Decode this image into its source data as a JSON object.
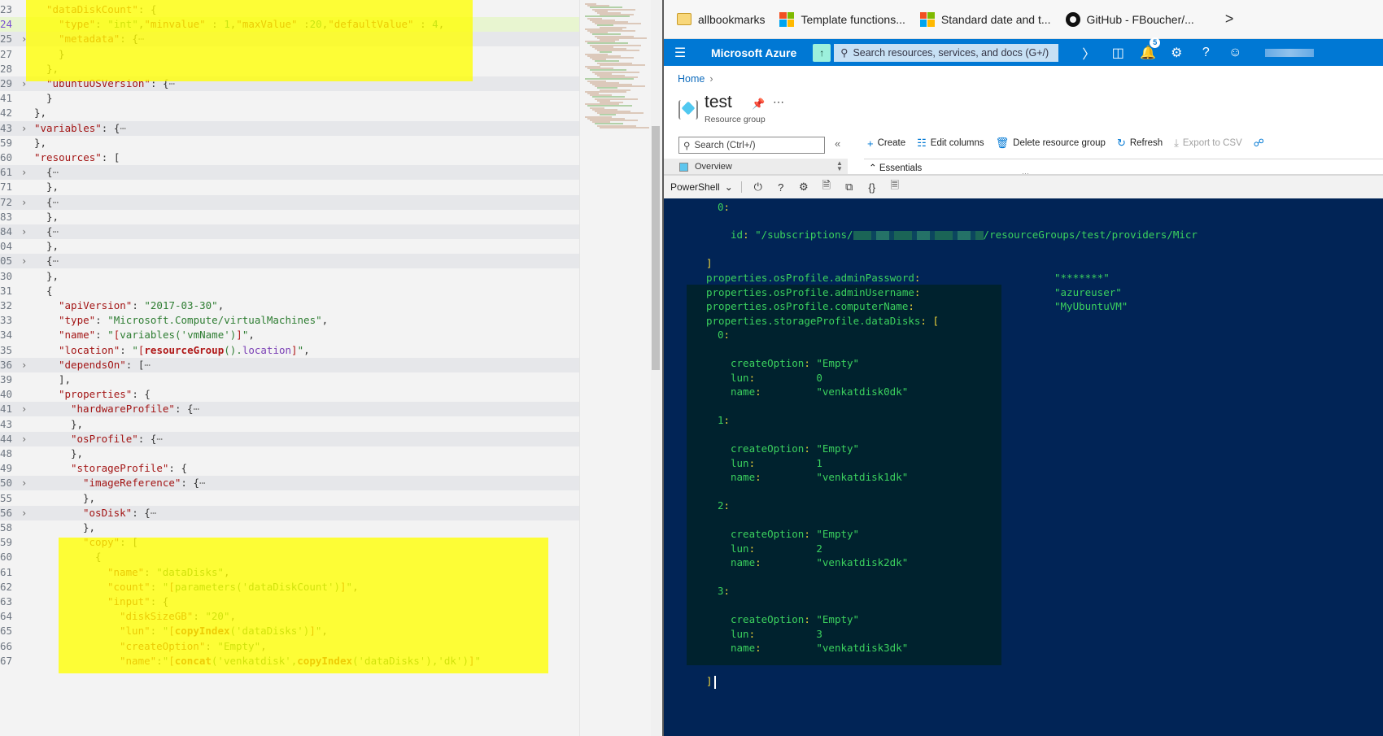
{
  "editor": {
    "lines": [
      {
        "ln": "23",
        "fold": false,
        "html_key": "dataDiskCount_open",
        "indent": 2
      },
      {
        "ln": "24",
        "fold": false,
        "html_key": "type_line",
        "indent": 3,
        "active": true
      },
      {
        "ln": "25",
        "fold": true,
        "html_key": "metadata",
        "indent": 3
      },
      {
        "ln": "27",
        "fold": false,
        "html_key": "close_brace",
        "indent": 3
      },
      {
        "ln": "28",
        "fold": false,
        "html_key": "close_brace_comma",
        "indent": 2
      },
      {
        "ln": "29",
        "fold": true,
        "html_key": "ubuntuOSVersion",
        "indent": 2
      },
      {
        "ln": "41",
        "fold": false,
        "html_key": "close_brace",
        "indent": 2
      },
      {
        "ln": "42",
        "fold": false,
        "html_key": "close_brace_comma",
        "indent": 1
      },
      {
        "ln": "43",
        "fold": true,
        "html_key": "variables",
        "indent": 1
      },
      {
        "ln": "59",
        "fold": false,
        "html_key": "close_brace_comma",
        "indent": 1
      },
      {
        "ln": "60",
        "fold": false,
        "html_key": "resources",
        "indent": 1
      },
      {
        "ln": "61",
        "fold": true,
        "html_key": "obj_folded",
        "indent": 2
      },
      {
        "ln": "71",
        "fold": false,
        "html_key": "close_brace_comma",
        "indent": 2
      },
      {
        "ln": "72",
        "fold": true,
        "html_key": "obj_folded",
        "indent": 2
      },
      {
        "ln": "83",
        "fold": false,
        "html_key": "close_brace_comma",
        "indent": 2
      },
      {
        "ln": "84",
        "fold": true,
        "html_key": "obj_folded",
        "indent": 2
      },
      {
        "ln": "04",
        "fold": false,
        "html_key": "close_brace_comma",
        "indent": 2
      },
      {
        "ln": "05",
        "fold": true,
        "html_key": "obj_folded",
        "indent": 2
      },
      {
        "ln": "30",
        "fold": false,
        "html_key": "close_brace_comma",
        "indent": 2
      },
      {
        "ln": "31",
        "fold": false,
        "html_key": "open_brace",
        "indent": 2
      },
      {
        "ln": "32",
        "fold": false,
        "html_key": "apiVersion",
        "indent": 3
      },
      {
        "ln": "33",
        "fold": false,
        "html_key": "type_vm",
        "indent": 3
      },
      {
        "ln": "34",
        "fold": false,
        "html_key": "name_vm",
        "indent": 3
      },
      {
        "ln": "35",
        "fold": false,
        "html_key": "location",
        "indent": 3
      },
      {
        "ln": "36",
        "fold": true,
        "html_key": "dependsOn",
        "indent": 3
      },
      {
        "ln": "39",
        "fold": false,
        "html_key": "close_bracket_comma",
        "indent": 3
      },
      {
        "ln": "40",
        "fold": false,
        "html_key": "properties",
        "indent": 3
      },
      {
        "ln": "41",
        "fold": true,
        "html_key": "hardwareProfile",
        "indent": 4
      },
      {
        "ln": "43",
        "fold": false,
        "html_key": "close_brace_comma",
        "indent": 4
      },
      {
        "ln": "44",
        "fold": true,
        "html_key": "osProfile",
        "indent": 4
      },
      {
        "ln": "48",
        "fold": false,
        "html_key": "close_brace_comma",
        "indent": 4
      },
      {
        "ln": "49",
        "fold": false,
        "html_key": "storageProfile",
        "indent": 4
      },
      {
        "ln": "50",
        "fold": true,
        "html_key": "imageReference",
        "indent": 5
      },
      {
        "ln": "55",
        "fold": false,
        "html_key": "close_brace_comma",
        "indent": 5
      },
      {
        "ln": "56",
        "fold": true,
        "html_key": "osDisk",
        "indent": 5
      },
      {
        "ln": "58",
        "fold": false,
        "html_key": "close_brace_comma",
        "indent": 5
      },
      {
        "ln": "59",
        "fold": false,
        "html_key": "copy",
        "indent": 5
      },
      {
        "ln": "60",
        "fold": false,
        "html_key": "open_brace",
        "indent": 6
      },
      {
        "ln": "61",
        "fold": false,
        "html_key": "copy_name",
        "indent": 7
      },
      {
        "ln": "62",
        "fold": false,
        "html_key": "copy_count",
        "indent": 7
      },
      {
        "ln": "63",
        "fold": false,
        "html_key": "copy_input",
        "indent": 7
      },
      {
        "ln": "64",
        "fold": false,
        "html_key": "diskSizeGB",
        "indent": 8
      },
      {
        "ln": "65",
        "fold": false,
        "html_key": "lun",
        "indent": 8
      },
      {
        "ln": "66",
        "fold": false,
        "html_key": "createOption",
        "indent": 8
      },
      {
        "ln": "67",
        "fold": false,
        "html_key": "disk_name",
        "indent": 8
      }
    ],
    "tokens": {
      "dataDiskCount_open": [
        [
          "k",
          "\"dataDiskCount\""
        ],
        [
          "p",
          ": "
        ],
        [
          "p",
          "{"
        ]
      ],
      "type_line": [
        [
          "k",
          "\"type\""
        ],
        [
          "p",
          ": "
        ],
        [
          "s",
          "\"int\""
        ],
        [
          "p",
          ","
        ],
        [
          "k",
          "\"minvalue\""
        ],
        [
          "p",
          " : "
        ],
        [
          "n",
          "1"
        ],
        [
          "p",
          ","
        ],
        [
          "k",
          "\"maxValue\""
        ],
        [
          "p",
          " :"
        ],
        [
          "n",
          "20"
        ],
        [
          "p",
          ","
        ],
        [
          "k",
          "\"defaultValue\""
        ],
        [
          "p",
          " : "
        ],
        [
          "n",
          "4"
        ],
        [
          "p",
          ","
        ]
      ],
      "metadata": [
        [
          "k",
          "\"metadata\""
        ],
        [
          "p",
          ": {"
        ],
        [
          "dots",
          "⋯"
        ]
      ],
      "close_brace": [
        [
          "p",
          "}"
        ]
      ],
      "close_brace_comma": [
        [
          "p",
          "},"
        ]
      ],
      "close_bracket_comma": [
        [
          "p",
          "],"
        ]
      ],
      "open_brace": [
        [
          "p",
          "{"
        ]
      ],
      "ubuntuOSVersion": [
        [
          "k",
          "\"ubuntuOSVersion\""
        ],
        [
          "p",
          ": {"
        ],
        [
          "dots",
          "⋯"
        ]
      ],
      "variables": [
        [
          "k",
          "\"variables\""
        ],
        [
          "p",
          ": {"
        ],
        [
          "dots",
          "⋯"
        ]
      ],
      "resources": [
        [
          "k",
          "\"resources\""
        ],
        [
          "p",
          ": ["
        ]
      ],
      "obj_folded": [
        [
          "p",
          "{"
        ],
        [
          "dots",
          "⋯"
        ]
      ],
      "apiVersion": [
        [
          "k",
          "\"apiVersion\""
        ],
        [
          "p",
          ": "
        ],
        [
          "s",
          "\"2017-03-30\""
        ],
        [
          "p",
          ","
        ]
      ],
      "type_vm": [
        [
          "k",
          "\"type\""
        ],
        [
          "p",
          ": "
        ],
        [
          "s",
          "\"Microsoft.Compute/virtualMachines\""
        ],
        [
          "p",
          ","
        ]
      ],
      "name_vm": [
        [
          "k",
          "\"name\""
        ],
        [
          "p",
          ": "
        ],
        [
          "s",
          "\""
        ],
        [
          "br",
          "["
        ],
        [
          "s",
          "variables('vmName')"
        ],
        [
          "br",
          "]"
        ],
        [
          "s",
          "\""
        ],
        [
          "p",
          ","
        ]
      ],
      "location": [
        [
          "k",
          "\"location\""
        ],
        [
          "p",
          ": "
        ],
        [
          "s",
          "\""
        ],
        [
          "br",
          "["
        ],
        [
          "f",
          "resourceGroup"
        ],
        [
          "s",
          "()."
        ],
        [
          "prop",
          "location"
        ],
        [
          "br",
          "]"
        ],
        [
          "s",
          "\""
        ],
        [
          "p",
          ","
        ]
      ],
      "dependsOn": [
        [
          "k",
          "\"dependsOn\""
        ],
        [
          "p",
          ": ["
        ],
        [
          "dots",
          "⋯"
        ]
      ],
      "properties": [
        [
          "k",
          "\"properties\""
        ],
        [
          "p",
          ": {"
        ]
      ],
      "hardwareProfile": [
        [
          "k",
          "\"hardwareProfile\""
        ],
        [
          "p",
          ": {"
        ],
        [
          "dots",
          "⋯"
        ]
      ],
      "osProfile": [
        [
          "k",
          "\"osProfile\""
        ],
        [
          "p",
          ": {"
        ],
        [
          "dots",
          "⋯"
        ]
      ],
      "storageProfile": [
        [
          "k",
          "\"storageProfile\""
        ],
        [
          "p",
          ": {"
        ]
      ],
      "imageReference": [
        [
          "k",
          "\"imageReference\""
        ],
        [
          "p",
          ": {"
        ],
        [
          "dots",
          "⋯"
        ]
      ],
      "osDisk": [
        [
          "k",
          "\"osDisk\""
        ],
        [
          "p",
          ": {"
        ],
        [
          "dots",
          "⋯"
        ]
      ],
      "copy": [
        [
          "k",
          "\"copy\""
        ],
        [
          "p",
          ": ["
        ]
      ],
      "copy_name": [
        [
          "k",
          "\"name\""
        ],
        [
          "p",
          ": "
        ],
        [
          "s",
          "\"dataDisks\""
        ],
        [
          "p",
          ","
        ]
      ],
      "copy_count": [
        [
          "k",
          "\"count\""
        ],
        [
          "p",
          ": "
        ],
        [
          "s",
          "\""
        ],
        [
          "br",
          "["
        ],
        [
          "s",
          "parameters('dataDiskCount')"
        ],
        [
          "br",
          "]"
        ],
        [
          "s",
          "\""
        ],
        [
          "p",
          ","
        ]
      ],
      "copy_input": [
        [
          "k",
          "\"input\""
        ],
        [
          "p",
          ": {"
        ]
      ],
      "diskSizeGB": [
        [
          "k",
          "\"diskSizeGB\""
        ],
        [
          "p",
          ": "
        ],
        [
          "s",
          "\"20\""
        ],
        [
          "p",
          ","
        ]
      ],
      "lun": [
        [
          "k",
          "\"lun\""
        ],
        [
          "p",
          ": "
        ],
        [
          "s",
          "\""
        ],
        [
          "br",
          "["
        ],
        [
          "f",
          "copyIndex"
        ],
        [
          "s",
          "('dataDisks')"
        ],
        [
          "br",
          "]"
        ],
        [
          "s",
          "\""
        ],
        [
          "p",
          ","
        ]
      ],
      "createOption": [
        [
          "k",
          "\"createOption\""
        ],
        [
          "p",
          ": "
        ],
        [
          "s",
          "\"Empty\""
        ],
        [
          "p",
          ","
        ]
      ],
      "disk_name": [
        [
          "k",
          "\"name\""
        ],
        [
          "p",
          ":"
        ],
        [
          "s",
          "\""
        ],
        [
          "br",
          "["
        ],
        [
          "f",
          "concat"
        ],
        [
          "s",
          "('venkatdisk',"
        ],
        [
          "f",
          "copyIndex"
        ],
        [
          "s",
          "('dataDisks'),'dk')"
        ],
        [
          "br",
          "]"
        ],
        [
          "s",
          "\""
        ]
      ]
    }
  },
  "browser": {
    "bookmarks": [
      {
        "label": "allbookmarks",
        "icon": "folder-icon"
      },
      {
        "label": "Template functions...",
        "icon": "microsoft-icon"
      },
      {
        "label": "Standard date and t...",
        "icon": "microsoft-icon"
      },
      {
        "label": "GitHub - FBoucher/...",
        "icon": "github-icon"
      }
    ],
    "bookmarks_more": ">",
    "azure": {
      "brand": "Microsoft Azure",
      "search_placeholder": "Search resources, services, and docs (G+/)",
      "notification_count": "5",
      "accent": "#0078d4"
    },
    "portal": {
      "breadcrumb": "Home",
      "title": "test",
      "subtitle": "Resource group",
      "search_placeholder": "Search (Ctrl+/)",
      "commands": [
        {
          "label": "Create",
          "icon": "+",
          "disabled": false
        },
        {
          "label": "Edit columns",
          "icon": "☷",
          "disabled": false
        },
        {
          "label": "Delete resource group",
          "icon": "🗑",
          "disabled": false
        },
        {
          "label": "Refresh",
          "icon": "↻",
          "disabled": false
        },
        {
          "label": "Export to CSV",
          "icon": "⤓",
          "disabled": true
        }
      ],
      "menu_item": "Overview",
      "essentials": "Essentials"
    },
    "shell": {
      "shell_type": "PowerShell"
    },
    "terminal": {
      "index0": "0:",
      "id_key": "id:",
      "id_prefix": "\"/subscriptions/",
      "id_suffix": "/resourceGroups/test/providers/Micr",
      "close_bracket": "]",
      "props": [
        {
          "key": "properties.osProfile.adminPassword",
          "value": "\"*******\""
        },
        {
          "key": "properties.osProfile.adminUsername",
          "value": "\"azureuser\""
        },
        {
          "key": "properties.osProfile.computerName",
          "value": "\"MyUbuntuVM\""
        }
      ],
      "datadisks_key": "properties.storageProfile.dataDisks",
      "disks": [
        {
          "index": "0",
          "createOption": "\"Empty\"",
          "lun": "0",
          "name": "\"venkatdisk0dk\""
        },
        {
          "index": "1",
          "createOption": "\"Empty\"",
          "lun": "1",
          "name": "\"venkatdisk1dk\""
        },
        {
          "index": "2",
          "createOption": "\"Empty\"",
          "lun": "2",
          "name": "\"venkatdisk2dk\""
        },
        {
          "index": "3",
          "createOption": "\"Empty\"",
          "lun": "3",
          "name": "\"venkatdisk3dk\""
        }
      ],
      "labels": {
        "createOption": "createOption",
        "lun": "lun",
        "name": "name"
      }
    }
  }
}
